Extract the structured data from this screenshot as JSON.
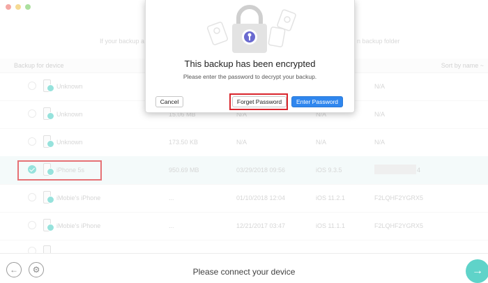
{
  "window": {
    "hints": {
      "left": "If your backup a",
      "right": "n backup folder"
    }
  },
  "table": {
    "header_left": "Backup for device",
    "header_right": "Sort by name ~",
    "rows": [
      {
        "name": "Unknown",
        "size": "",
        "date": "",
        "ios": "",
        "serial": "N/A",
        "selected": false,
        "redacted": false
      },
      {
        "name": "Unknown",
        "size": "15.06 MB",
        "date": "N/A",
        "ios": "N/A",
        "serial": "N/A",
        "selected": false,
        "redacted": false
      },
      {
        "name": "Unknown",
        "size": "173.50 KB",
        "date": "N/A",
        "ios": "N/A",
        "serial": "N/A",
        "selected": false,
        "redacted": false
      },
      {
        "name": "iPhone 5s",
        "size": "950.69 MB",
        "date": "03/29/2018 09:56",
        "ios": "iOS 9.3.5",
        "serial": "4",
        "selected": true,
        "redacted": true
      },
      {
        "name": "iMobie's iPhone",
        "size": "...",
        "date": "01/10/2018 12:04",
        "ios": "iOS 11.2.1",
        "serial": "F2LQHF2YGRX5",
        "selected": false,
        "redacted": false
      },
      {
        "name": "iMobie's iPhone",
        "size": "...",
        "date": "12/21/2017 03:47",
        "ios": "iOS 11.1.1",
        "serial": "F2LQHF2YGRX5",
        "selected": false,
        "redacted": false
      }
    ]
  },
  "dialog": {
    "title": "This backup has been encrypted",
    "message": "Please enter the password to decrypt your backup.",
    "cancel_label": "Cancel",
    "forget_label": "Forget Password",
    "enter_label": "Enter Password"
  },
  "bottom": {
    "status": "Please connect your device",
    "back_icon": "arrow-left-icon",
    "settings_icon": "gear-icon",
    "next_icon": "arrow-right-icon"
  },
  "colors": {
    "accent": "#5fd3c9",
    "primary_button": "#2f86ee",
    "highlight": "#d9252c"
  }
}
